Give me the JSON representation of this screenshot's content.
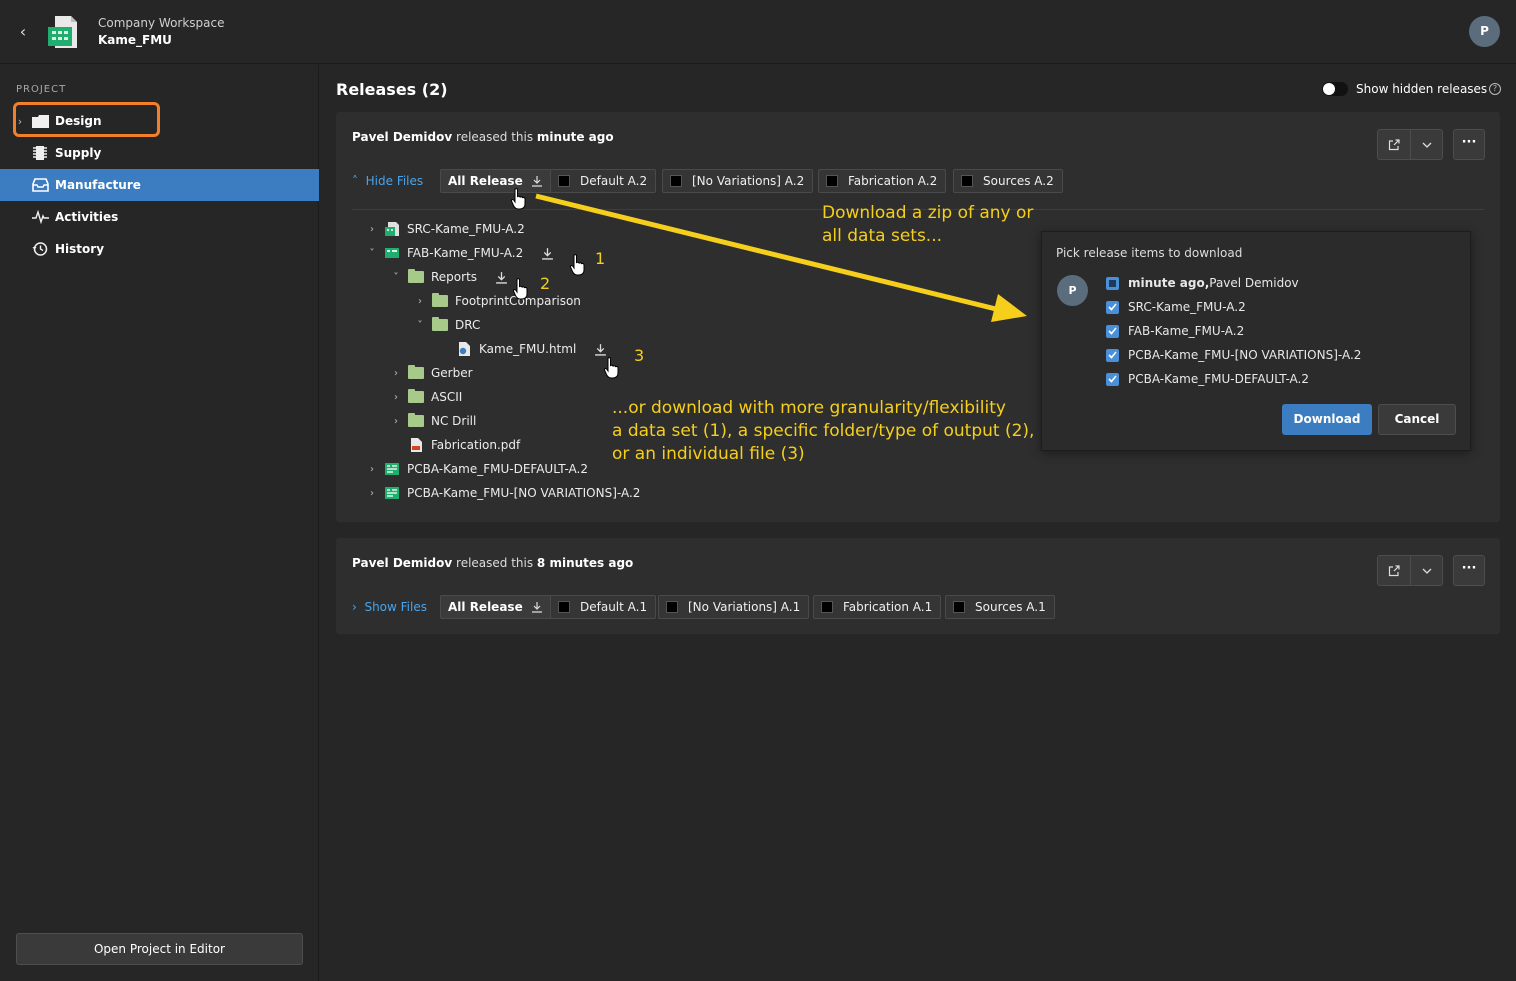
{
  "header": {
    "workspace": "Company Workspace",
    "project": "Kame_FMU",
    "avatar": "P"
  },
  "sidebar": {
    "section": "PROJECT",
    "items": [
      {
        "label": "Design",
        "icon": "folder-icon"
      },
      {
        "label": "Supply",
        "icon": "chip-icon"
      },
      {
        "label": "Manufacture",
        "icon": "inbox-icon",
        "active": true
      },
      {
        "label": "Activities",
        "icon": "activity-icon"
      },
      {
        "label": "History",
        "icon": "history-icon"
      }
    ],
    "open_editor": "Open Project in Editor"
  },
  "main": {
    "title": "Releases (2)",
    "show_hidden": "Show hidden releases"
  },
  "release1": {
    "user": "Pavel Demidov",
    "text": " released this ",
    "when": "minute ago",
    "files_toggle": "Hide Files",
    "chips": [
      "All Release",
      "Default A.2",
      "[No Variations] A.2",
      "Fabrication A.2",
      "Sources A.2"
    ],
    "tree": [
      "SRC-Kame_FMU-A.2",
      "FAB-Kame_FMU-A.2",
      "Reports",
      "FootprintComparison",
      "DRC",
      "Kame_FMU.html",
      "Gerber",
      "ASCII",
      "NC Drill",
      "Fabrication.pdf",
      "PCBA-Kame_FMU-DEFAULT-A.2",
      "PCBA-Kame_FMU-[NO VARIATIONS]-A.2"
    ]
  },
  "release2": {
    "user": "Pavel Demidov",
    "text": " released this ",
    "when": "8 minutes ago",
    "files_toggle": "Show Files",
    "chips": [
      "All Release",
      "Default A.1",
      "[No Variations] A.1",
      "Fabrication A.1",
      "Sources A.1"
    ]
  },
  "popup": {
    "title": "Pick release items to download",
    "avatar": "P",
    "rows": [
      {
        "bold": "minute ago,",
        "text": " Pavel Demidov",
        "state": "partial"
      },
      {
        "text": "SRC-Kame_FMU-A.2",
        "state": "checked"
      },
      {
        "text": "FAB-Kame_FMU-A.2",
        "state": "checked"
      },
      {
        "text": "PCBA-Kame_FMU-[NO VARIATIONS]-A.2",
        "state": "checked"
      },
      {
        "text": "PCBA-Kame_FMU-DEFAULT-A.2",
        "state": "checked"
      }
    ],
    "download": "Download",
    "cancel": "Cancel"
  },
  "annotations": {
    "top1": "Download a zip of any or",
    "top2": "all data sets...",
    "mid1": "...or download with more granularity/flexibility",
    "mid2": "a data set (1), a specific folder/type of output (2),",
    "mid3": "or an individual file (3)",
    "n1": "1",
    "n2": "2",
    "n3": "3",
    "color": "#f5cf1b"
  },
  "colors": {
    "accent": "#3b7dc0",
    "link": "#4aa3e8",
    "highlight": "#f2802a"
  }
}
